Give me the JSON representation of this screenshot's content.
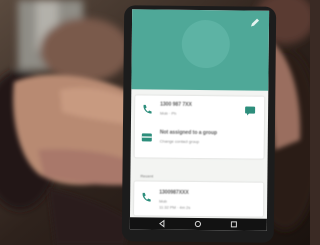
{
  "contact_screen": {
    "primary_card": {
      "phone_number": "1300 987 7XX",
      "phone_type": "Mob · Ph",
      "group_text": "Not assigned to a group",
      "group_subtext": "Change contact group"
    },
    "recent_section": {
      "label": "Recent",
      "number": "1300987XXX",
      "type": "Mob",
      "timestamp": "11:32 PM · 4m 2s"
    }
  },
  "colors": {
    "header": "#4fa898",
    "accent": "#2d8e7c",
    "screen_bg": "#f3f4f2"
  }
}
